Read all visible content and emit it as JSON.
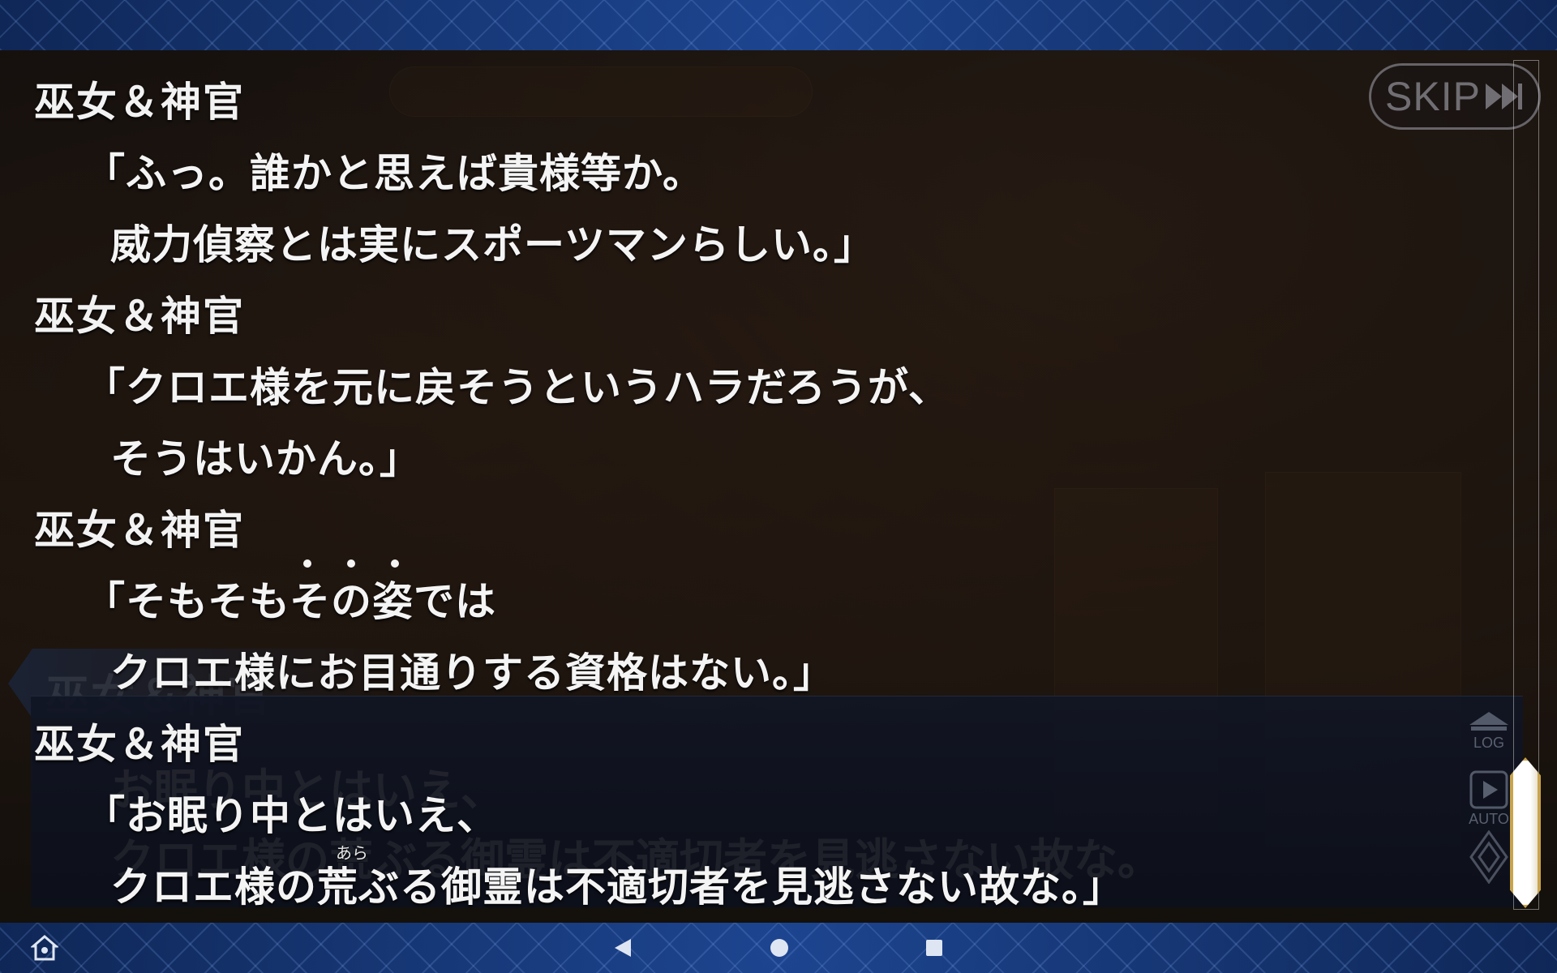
{
  "log": {
    "entries": [
      {
        "speaker": "巫女＆神官",
        "lines": [
          "「ふっ。誰かと思えば貴様等か。",
          "威力偵察とは実にスポーツマンらしい。」"
        ]
      },
      {
        "speaker": "巫女＆神官",
        "lines": [
          "「クロエ様を元に戻そうというハラだろうが、",
          "そうはいかん。」"
        ]
      },
      {
        "speaker": "巫女＆神官",
        "lines": [
          "「そもそもその姿では",
          "クロエ様にお目通りする資格はない。」"
        ]
      },
      {
        "speaker": "巫女＆神官",
        "lines": [
          "「お眠り中とはいえ、",
          "クロエ様の荒ぶる御霊は不適切者を見逃さない故な。」"
        ],
        "ruby": "あら"
      }
    ]
  },
  "dialog": {
    "speaker": "巫女＆神官",
    "lines": [
      "お眠り中とはいえ、",
      "クロエ様の荒ぶる御霊は不適切者を見逃さない故な。"
    ]
  },
  "controls": {
    "skip_label": "SKIP",
    "log_label": "LOG",
    "auto_label": "AUTO"
  },
  "icons": {
    "skip": "fast-forward-icon",
    "log": "log-up-icon",
    "auto": "play-icon",
    "menu": "diamond-icon",
    "home": "home-icon",
    "back": "back-triangle-icon",
    "nav_home": "home-circle-icon",
    "recents": "recents-square-icon"
  }
}
